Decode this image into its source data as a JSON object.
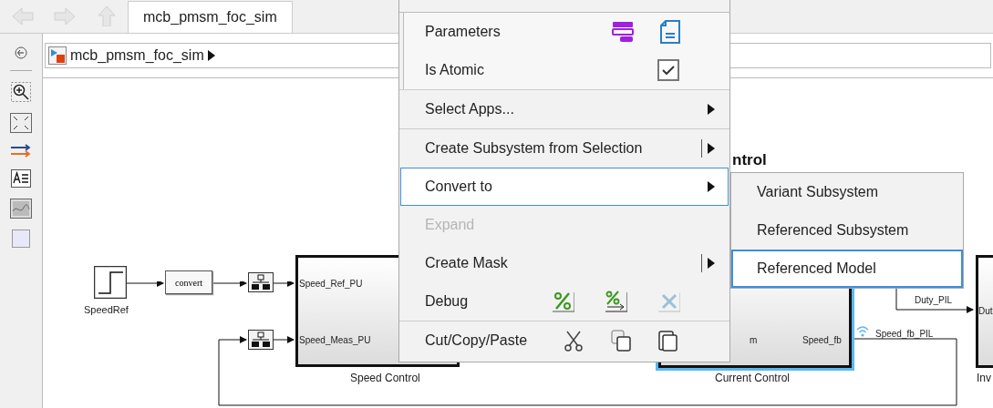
{
  "nav": [
    {
      "kind": "back",
      "disabled": true
    },
    {
      "kind": "forward",
      "disabled": true
    },
    {
      "kind": "up",
      "disabled": true
    }
  ],
  "tabs": [
    {
      "label": "mcb_pmsm_foc_sim",
      "selected": true
    }
  ],
  "breadcrumb": {
    "label": "mcb_pmsm_foc_sim"
  },
  "context_menu": {
    "items": [
      {
        "label": "Parameters",
        "kind": "parameters",
        "selected": false,
        "disabled": false
      },
      {
        "label": "Is Atomic",
        "kind": "checkbox",
        "checked": true,
        "selected": false,
        "disabled": false
      },
      {
        "label": "Select Apps...",
        "kind": "submenu",
        "selected": false,
        "disabled": false
      },
      {
        "label": "Create Subsystem from Selection",
        "kind": "split",
        "selected": false,
        "disabled": false
      },
      {
        "label": "Convert to",
        "kind": "submenu",
        "selected": true,
        "disabled": false
      },
      {
        "label": "Expand",
        "kind": "plain",
        "selected": false,
        "disabled": true
      },
      {
        "label": "Create Mask",
        "kind": "split",
        "selected": false,
        "disabled": false
      },
      {
        "label": "Debug",
        "kind": "debug",
        "selected": false,
        "disabled": false
      },
      {
        "label": "Cut/Copy/Paste",
        "kind": "clipboard",
        "selected": false,
        "disabled": false
      }
    ]
  },
  "submenu": {
    "items": [
      {
        "label": "Variant Subsystem",
        "selected": false
      },
      {
        "label": "Referenced Subsystem",
        "selected": false
      },
      {
        "label": "Referenced Model",
        "selected": true
      }
    ]
  },
  "diagram": {
    "heading": "ntrol",
    "blocks": [
      {
        "kind": "step",
        "label": "SpeedRef"
      },
      {
        "kind": "convert",
        "text": "convert"
      },
      {
        "kind": "bus"
      },
      {
        "kind": "bus"
      },
      {
        "kind": "subsystem",
        "label": "Speed Control",
        "selected": false,
        "inputs": [
          "Speed_Ref_PU",
          "Speed_Meas_PU"
        ]
      },
      {
        "kind": "subsystem",
        "label": "Current Control",
        "selected": true,
        "inputs": [
          "m"
        ],
        "outputs": [
          "Speed_fb"
        ]
      },
      {
        "kind": "subsystem",
        "label": "Inv",
        "selected": false,
        "inputs": [
          "Dut"
        ]
      }
    ],
    "signals": [
      "Duty_PIL",
      "Speed_fb_PIL"
    ]
  }
}
